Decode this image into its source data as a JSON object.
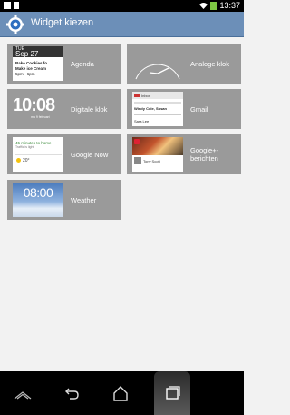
{
  "status_bar": {
    "time": "13:37"
  },
  "action_bar": {
    "title": "Widget kiezen"
  },
  "widgets": [
    {
      "name": "Agenda",
      "preview": {
        "day": "TUE",
        "date": "Sep 27",
        "event1": "Bake Cookies fo",
        "event2": "Make ice Cream",
        "event2_time": "5pm - 6pm"
      }
    },
    {
      "name": "Analoge klok"
    },
    {
      "name": "Digitale klok",
      "preview": {
        "time": "10:08",
        "date": "ma 9 februari"
      }
    },
    {
      "name": "Gmail",
      "preview": {
        "header": "Inbox",
        "sender1": "Windy Cole, Susan",
        "sender2": "Sara Lee"
      }
    },
    {
      "name": "Google Now",
      "preview": {
        "headline": "45 minutes to home",
        "traffic": "Traffic is light",
        "temp": "20°"
      }
    },
    {
      "name": "Google+-\nberichten",
      "preview": {
        "author": "Tony Scott"
      }
    },
    {
      "name": "Weather",
      "preview": {
        "time": "08:00"
      }
    }
  ]
}
